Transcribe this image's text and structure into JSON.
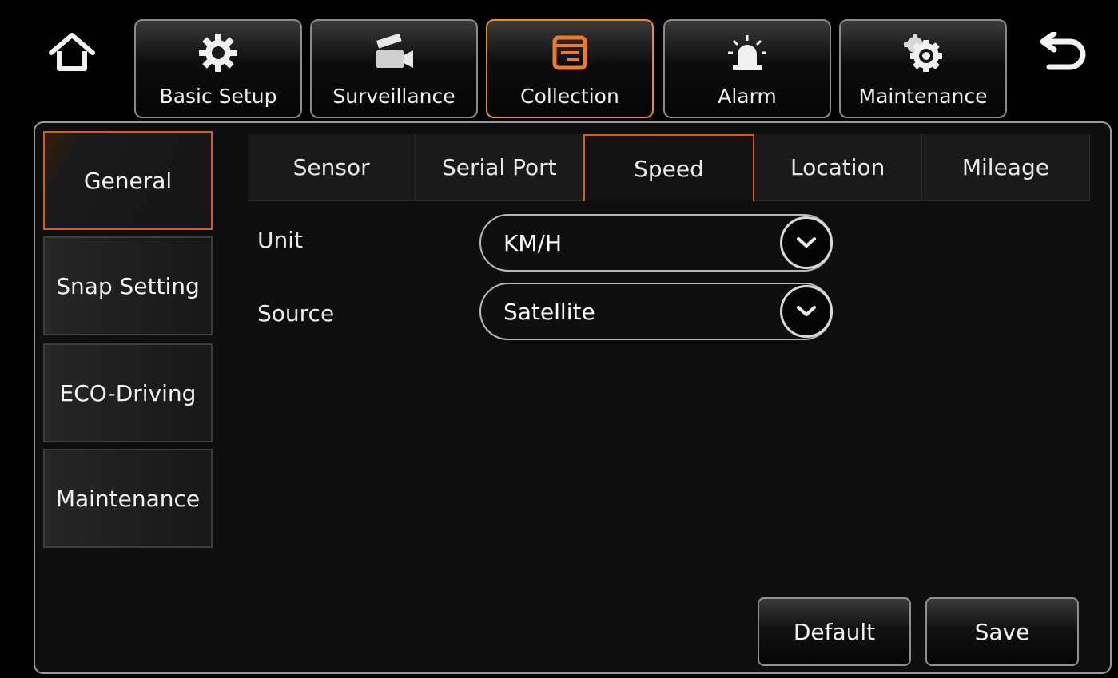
{
  "nav": {
    "home_icon": "home-icon",
    "back_icon": "back-arrow-icon",
    "tabs": [
      {
        "label": "Basic Setup",
        "icon": "gear-icon"
      },
      {
        "label": "Surveillance",
        "icon": "camera-icon"
      },
      {
        "label": "Collection",
        "icon": "collection-icon",
        "active": true
      },
      {
        "label": "Alarm",
        "icon": "alarm-icon"
      },
      {
        "label": "Maintenance",
        "icon": "gears-icon"
      }
    ]
  },
  "sidebar": {
    "items": [
      {
        "label": "General",
        "active": true
      },
      {
        "label": "Snap Setting"
      },
      {
        "label": "ECO-Driving"
      },
      {
        "label": "Maintenance"
      }
    ]
  },
  "sub_tabs": [
    {
      "label": "Sensor"
    },
    {
      "label": "Serial Port"
    },
    {
      "label": "Speed",
      "active": true
    },
    {
      "label": "Location"
    },
    {
      "label": "Mileage"
    }
  ],
  "form": {
    "unit": {
      "label": "Unit",
      "value": "KM/H"
    },
    "source": {
      "label": "Source",
      "value": "Satellite"
    }
  },
  "buttons": {
    "default_label": "Default",
    "save_label": "Save"
  },
  "colors": {
    "accent": "#d85d14",
    "nav_active_border": "#e98a2b"
  }
}
